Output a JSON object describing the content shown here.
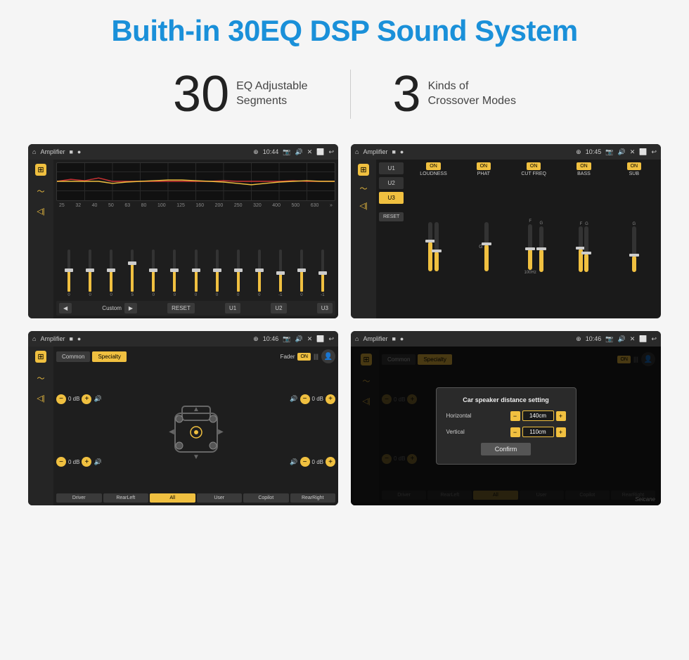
{
  "page": {
    "title": "Buith-in 30EQ DSP Sound System",
    "stats": [
      {
        "number": "30",
        "label": "EQ Adjustable\nSegments"
      },
      {
        "number": "3",
        "label": "Kinds of\nCrossover Modes"
      }
    ]
  },
  "screens": [
    {
      "id": "screen1",
      "topbar": {
        "title": "Amplifier",
        "time": "10:44"
      },
      "eq_labels": [
        "25",
        "32",
        "40",
        "50",
        "63",
        "80",
        "100",
        "125",
        "160",
        "200",
        "250",
        "320",
        "400",
        "500",
        "630"
      ],
      "eq_values": [
        "0",
        "0",
        "0",
        "5",
        "0",
        "0",
        "0",
        "0",
        "0",
        "0",
        "-1",
        "0",
        "-1"
      ],
      "preset": "Custom",
      "buttons": [
        "RESET",
        "U1",
        "U2",
        "U3"
      ]
    },
    {
      "id": "screen2",
      "topbar": {
        "title": "Amplifier",
        "time": "10:45"
      },
      "channels": [
        "LOUDNESS",
        "PHAT",
        "CUT FREQ",
        "BASS",
        "SUB"
      ],
      "u_buttons": [
        "U1",
        "U2",
        "U3"
      ],
      "active_u": "U3",
      "reset_label": "RESET"
    },
    {
      "id": "screen3",
      "topbar": {
        "title": "Amplifier",
        "time": "10:46"
      },
      "tabs": [
        "Common",
        "Specialty"
      ],
      "active_tab": "Specialty",
      "fader_label": "Fader",
      "fader_on": "ON",
      "db_values": [
        "0 dB",
        "0 dB",
        "0 dB",
        "0 dB"
      ],
      "position_buttons": [
        "Driver",
        "RearLeft",
        "All",
        "User",
        "Copilot",
        "RearRight"
      ],
      "active_position": "All"
    },
    {
      "id": "screen4",
      "topbar": {
        "title": "Amplifier",
        "time": "10:46"
      },
      "tabs": [
        "Common",
        "Specialty"
      ],
      "active_tab": "Specialty",
      "dialog": {
        "title": "Car speaker distance setting",
        "horizontal_label": "Horizontal",
        "horizontal_value": "140cm",
        "vertical_label": "Vertical",
        "vertical_value": "110cm",
        "confirm_label": "Confirm"
      },
      "db_values": [
        "0 dB",
        "0 dB"
      ],
      "position_buttons": [
        "Driver",
        "RearLeft",
        "All",
        "User",
        "Copilot",
        "RearRight"
      ],
      "watermark": "Seicane"
    }
  ],
  "icons": {
    "home": "⌂",
    "eq": "⊞",
    "wave": "〜",
    "speaker": "◁",
    "play": "▶",
    "back": "◁",
    "pause": "▮▮",
    "prev": "◀",
    "next": "▶",
    "gps": "⊕",
    "camera": "⬜",
    "volume": "🔊",
    "x": "✕",
    "return": "↩",
    "settings": "⚙",
    "person": "👤"
  }
}
